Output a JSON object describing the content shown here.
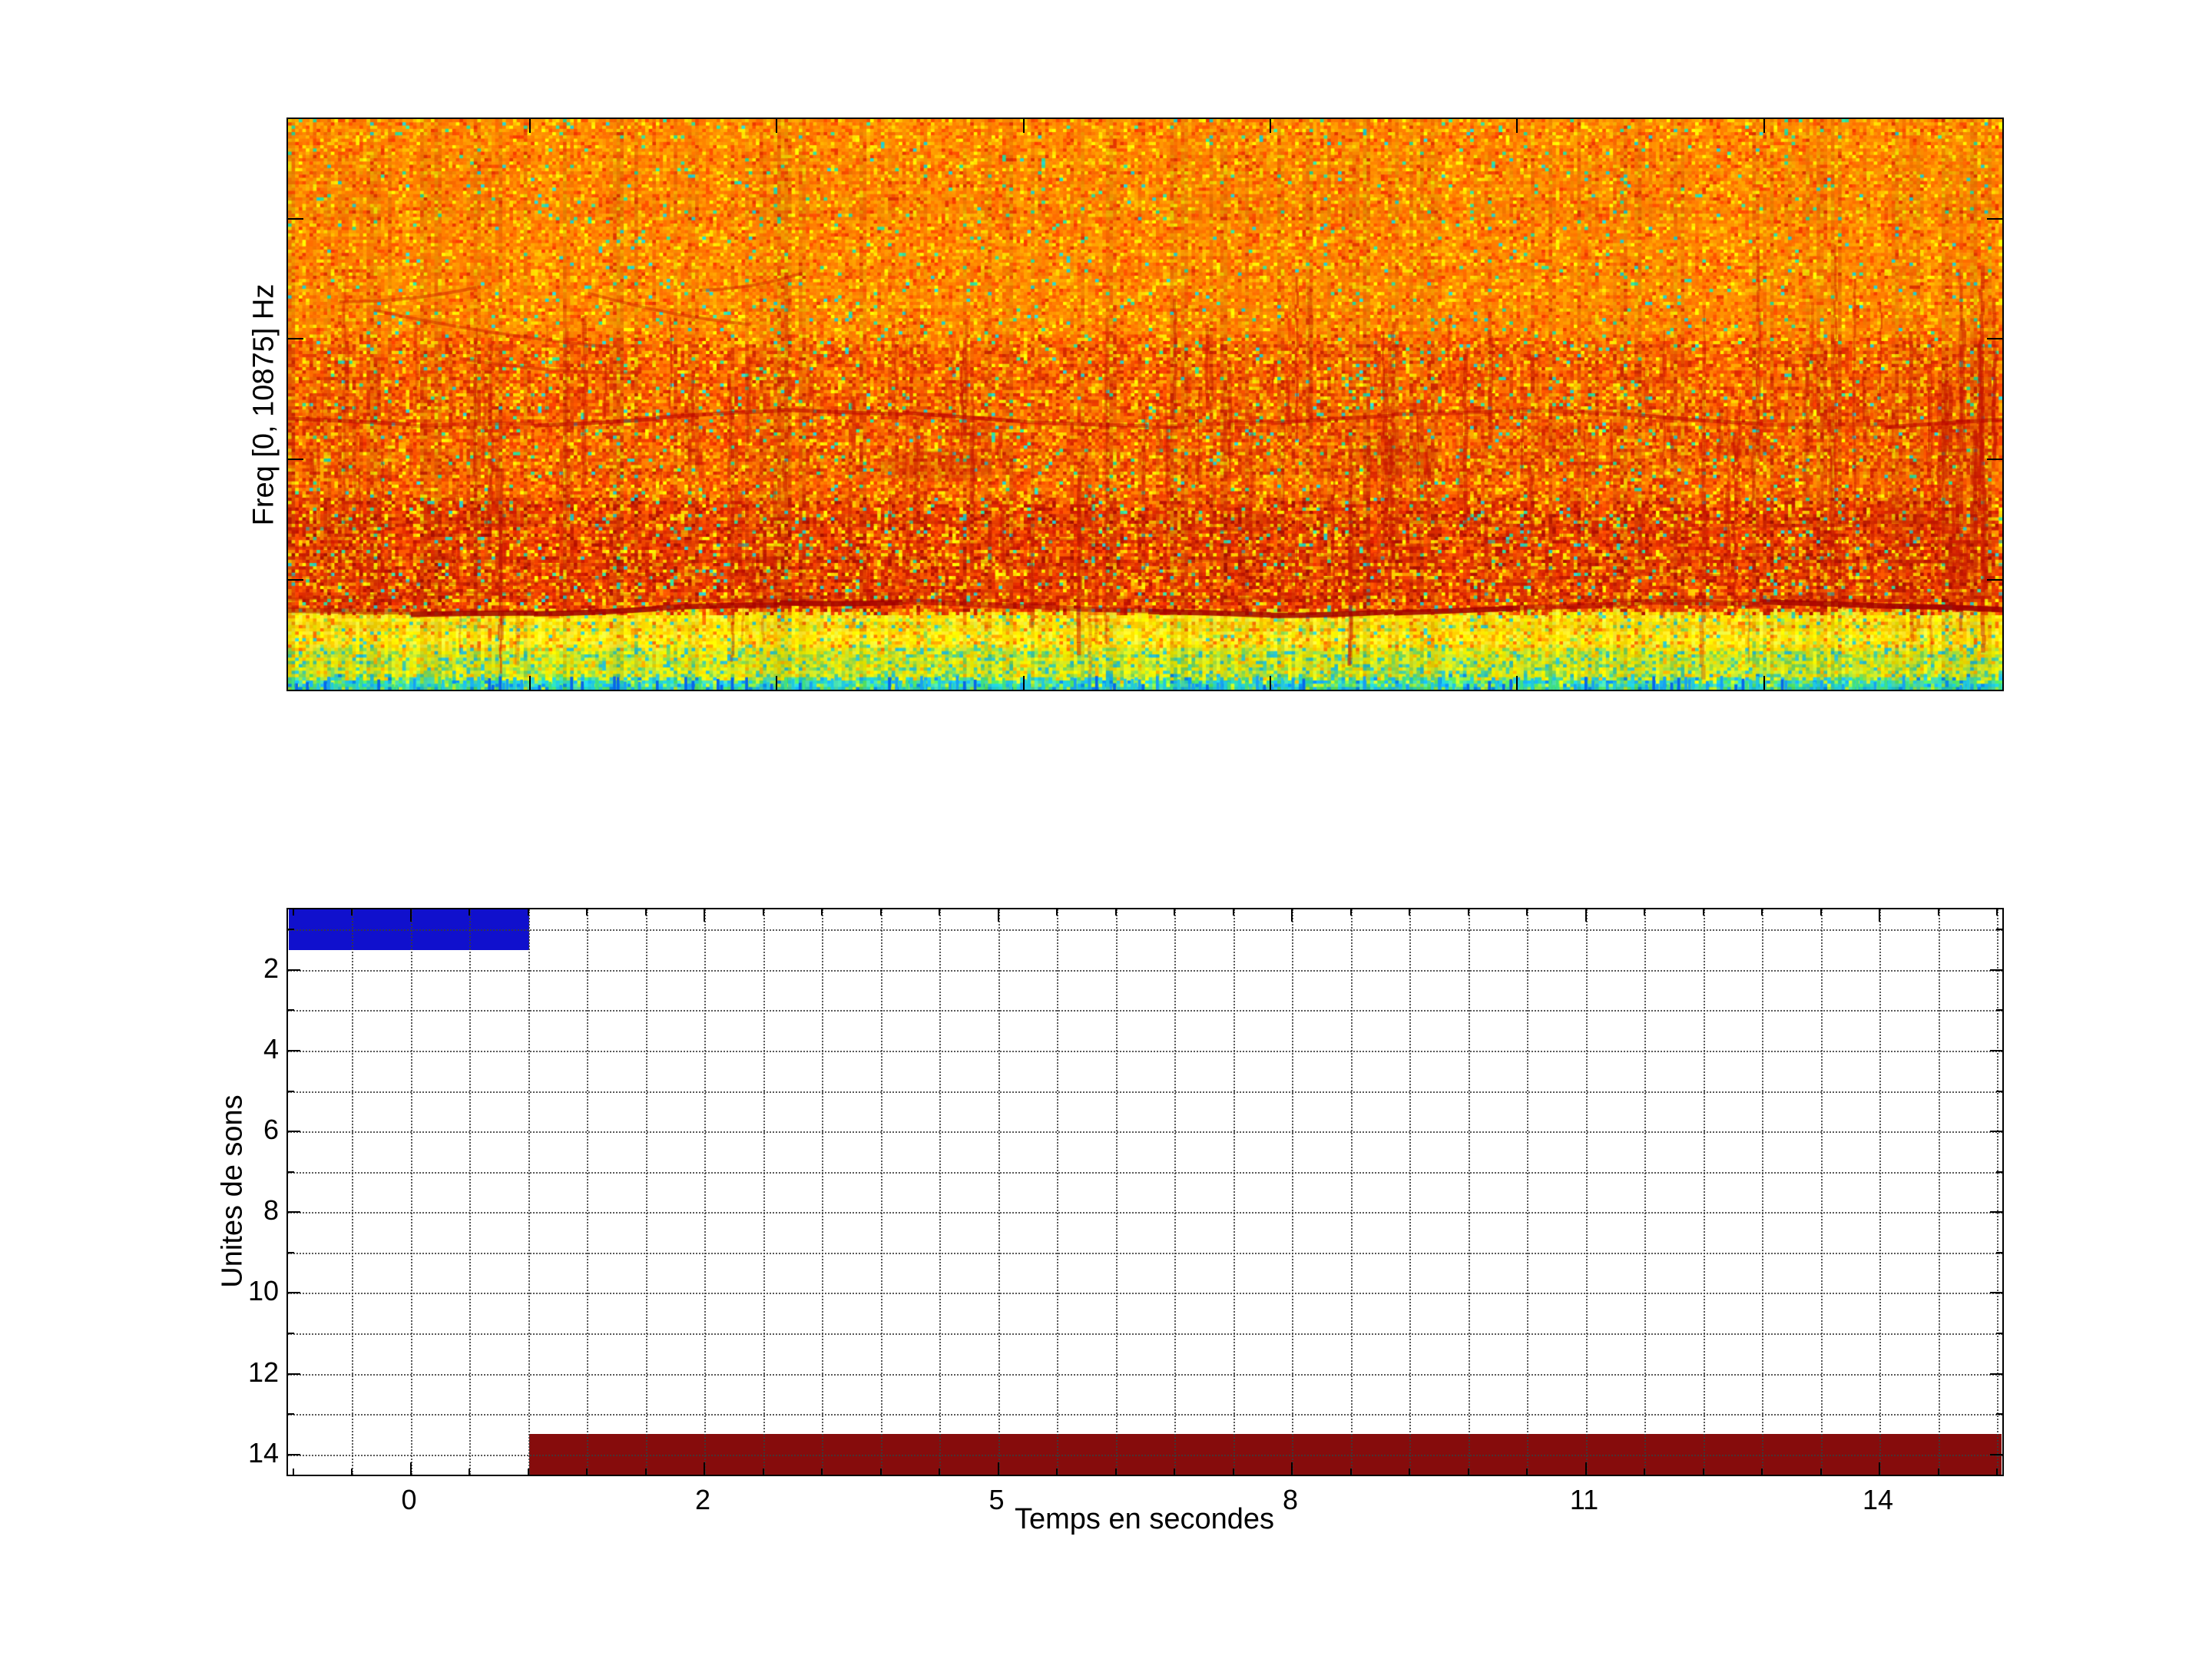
{
  "figure": {
    "background": "#ffffff"
  },
  "chart_data": [
    {
      "type": "heatmap",
      "subtype": "spectrogram",
      "title": "",
      "ylabel": "Freq [0, 10875] Hz",
      "freq_range_hz": [
        0,
        10875
      ],
      "colormap": "jet",
      "x_ticks_unlabeled": 6,
      "y_ticks_unlabeled": 4,
      "features": [
        "uniform bright orange broadband noise over the upper half",
        "denser red band with many vertical call streaks between ~38% and ~86% of plot height",
        "a few faint diagonal red whistle traces near 30-44% height on the left",
        "wavy dark-red tonal line near 52% height spanning full width",
        "stack of wavy dark-red harmonic lines between ~70% and ~84% height",
        "strong dark-red wavy line just above the yellow band (~86% height)",
        "bright yellow low-frequency band from ~86% to ~97% height",
        "thin cyan/green strip with blue vertical dashes along the bottom edge"
      ],
      "paint": {
        "cell_w": 4.65,
        "cell_h": 4.25,
        "seed": 7,
        "zones": [
          {
            "until": 0.38,
            "colors": [
              "#FF7A00",
              "#FF8C00",
              "#FF9D00",
              "#FF6B00",
              "#FFB400",
              "#FFD900",
              "#FFF200",
              "#FF4E00",
              "#E83600",
              "#2EDC9C",
              "#22D0D0"
            ],
            "weights": [
              22,
              20,
              14,
              14,
              8,
              6,
              2.5,
              8,
              3,
              1.2,
              0.8
            ]
          },
          {
            "until": 0.665,
            "colors": [
              "#FB6A00",
              "#FF8000",
              "#F25200",
              "#E83C00",
              "#D42800",
              "#FFA300",
              "#FFD200",
              "#FFF000",
              "#30DC96",
              "#28D0D0"
            ],
            "weights": [
              20,
              14,
              16,
              15,
              8,
              10,
              7,
              3,
              1.6,
              1
            ]
          },
          {
            "until": 0.861,
            "colors": [
              "#F45400",
              "#E84000",
              "#DC2C00",
              "#C81C00",
              "#B01000",
              "#FF8C00",
              "#FFC800",
              "#FFEE00",
              "#34D89C",
              "#2CC8C8"
            ],
            "weights": [
              18,
              18,
              16,
              10,
              6,
              12,
              8,
              4,
              2,
              1.5
            ]
          },
          {
            "until": 0.926,
            "colors": [
              "#FFDC00",
              "#FFE92A",
              "#F5F000",
              "#FFC400",
              "#FF9E00",
              "#E8F040",
              "#8CDC50",
              "#30C8C8",
              "#FF7000"
            ],
            "weights": [
              24,
              18,
              14,
              12,
              8,
              10,
              6,
              3,
              5
            ]
          },
          {
            "until": 0.978,
            "colors": [
              "#EEF000",
              "#DCEC20",
              "#C8E830",
              "#A0E040",
              "#78D858",
              "#40CCA0",
              "#28C0D0",
              "#FFB400",
              "#F0D800"
            ],
            "weights": [
              18,
              16,
              14,
              12,
              10,
              7,
              6,
              6,
              11
            ]
          },
          {
            "until": 1.0,
            "colors": [
              "#48D8A8",
              "#20C8D8",
              "#18B0F0",
              "#0888E8",
              "#50E060",
              "#90E840",
              "#C8F020",
              "#28D0B0"
            ],
            "weights": [
              20,
              18,
              10,
              6,
              16,
              12,
              8,
              10
            ]
          }
        ],
        "line_mid": {
          "y_frac": 0.525,
          "amp": 9,
          "period": 900,
          "width": 5,
          "alpha": 0.55,
          "color": "#B80000"
        },
        "line_low": {
          "y_frac": 0.857,
          "amp": 7,
          "period": 1100,
          "width": 7,
          "alpha": 0.75,
          "color": "#A00000"
        },
        "harmonics": {
          "y_fracs": [
            0.715,
            0.745,
            0.775,
            0.805,
            0.835
          ],
          "amp": 6,
          "period": 620,
          "width": 4,
          "alpha": 0.35,
          "color": "#C02000"
        },
        "streaks": {
          "count": 250,
          "y_band": [
            0.4,
            0.85
          ],
          "color": "#C41400"
        },
        "tall_streaks": [
          {
            "x_frac": 0.902,
            "y0": 0.22,
            "y1": 0.82
          },
          {
            "x_frac": 0.913,
            "y0": 0.28,
            "y1": 0.8
          }
        ],
        "cluster": {
          "x0": 0.965,
          "x1": 0.995,
          "count": 15,
          "y_band": [
            0.4,
            0.8
          ]
        },
        "diagonals": [
          [
            0.03,
            0.32,
            0.11,
            0.295
          ],
          [
            0.05,
            0.335,
            0.19,
            0.4
          ],
          [
            0.175,
            0.305,
            0.27,
            0.36
          ],
          [
            0.1,
            0.42,
            0.205,
            0.445
          ],
          [
            0.24,
            0.3,
            0.3,
            0.27
          ]
        ],
        "bottom_dashes": {
          "colors": [
            "#0864E8",
            "#18A0F0",
            "#20C8E0",
            "#40E080"
          ],
          "chance": 0.38
        }
      }
    },
    {
      "type": "bar",
      "subtype": "horizontal-activity-gantt",
      "xlabel": "Temps en secondes",
      "ylabel": "Unites de sons",
      "x_ticks": [
        0,
        2,
        5,
        8,
        11,
        14
      ],
      "y_ticks": [
        2,
        4,
        6,
        8,
        10,
        12,
        14
      ],
      "ylim": [
        0.5,
        14.5
      ],
      "xlim_s": [
        -0.83,
        15.25
      ],
      "grid": "dotted",
      "rows_total": 14,
      "segments": [
        {
          "row": 1,
          "start_s": -0.83,
          "end_s": 0.81,
          "color": "#1010CD"
        },
        {
          "row": 14,
          "start_s": 0.81,
          "end_s": 15.25,
          "color": "#860C0C"
        }
      ]
    }
  ]
}
